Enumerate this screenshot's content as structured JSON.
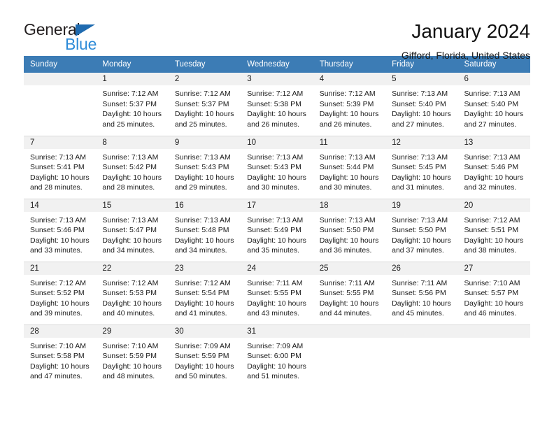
{
  "brand": {
    "name_part1": "General",
    "name_part2": "Blue",
    "triangle_color": "#1f6bb0",
    "blue_text_color": "#2e8bd8"
  },
  "header": {
    "title": "January 2024",
    "location": "Gifford, Florida, United States",
    "header_bg_color": "#3c7cb5",
    "daynum_bg_color": "#f1f1f1"
  },
  "weekday_headers": [
    "Sunday",
    "Monday",
    "Tuesday",
    "Wednesday",
    "Thursday",
    "Friday",
    "Saturday"
  ],
  "labels": {
    "sunrise_prefix": "Sunrise:",
    "sunset_prefix": "Sunset:",
    "daylight_prefix": "Daylight:"
  },
  "weeks": [
    [
      {
        "day": "",
        "blank": true,
        "line1": "",
        "line2": "",
        "line3": "",
        "line4": ""
      },
      {
        "day": "1",
        "line1": "Sunrise: 7:12 AM",
        "line2": "Sunset: 5:37 PM",
        "line3": "Daylight: 10 hours",
        "line4": "and 25 minutes."
      },
      {
        "day": "2",
        "line1": "Sunrise: 7:12 AM",
        "line2": "Sunset: 5:37 PM",
        "line3": "Daylight: 10 hours",
        "line4": "and 25 minutes."
      },
      {
        "day": "3",
        "line1": "Sunrise: 7:12 AM",
        "line2": "Sunset: 5:38 PM",
        "line3": "Daylight: 10 hours",
        "line4": "and 26 minutes."
      },
      {
        "day": "4",
        "line1": "Sunrise: 7:12 AM",
        "line2": "Sunset: 5:39 PM",
        "line3": "Daylight: 10 hours",
        "line4": "and 26 minutes."
      },
      {
        "day": "5",
        "line1": "Sunrise: 7:13 AM",
        "line2": "Sunset: 5:40 PM",
        "line3": "Daylight: 10 hours",
        "line4": "and 27 minutes."
      },
      {
        "day": "6",
        "line1": "Sunrise: 7:13 AM",
        "line2": "Sunset: 5:40 PM",
        "line3": "Daylight: 10 hours",
        "line4": "and 27 minutes."
      }
    ],
    [
      {
        "day": "7",
        "line1": "Sunrise: 7:13 AM",
        "line2": "Sunset: 5:41 PM",
        "line3": "Daylight: 10 hours",
        "line4": "and 28 minutes."
      },
      {
        "day": "8",
        "line1": "Sunrise: 7:13 AM",
        "line2": "Sunset: 5:42 PM",
        "line3": "Daylight: 10 hours",
        "line4": "and 28 minutes."
      },
      {
        "day": "9",
        "line1": "Sunrise: 7:13 AM",
        "line2": "Sunset: 5:43 PM",
        "line3": "Daylight: 10 hours",
        "line4": "and 29 minutes."
      },
      {
        "day": "10",
        "line1": "Sunrise: 7:13 AM",
        "line2": "Sunset: 5:43 PM",
        "line3": "Daylight: 10 hours",
        "line4": "and 30 minutes."
      },
      {
        "day": "11",
        "line1": "Sunrise: 7:13 AM",
        "line2": "Sunset: 5:44 PM",
        "line3": "Daylight: 10 hours",
        "line4": "and 30 minutes."
      },
      {
        "day": "12",
        "line1": "Sunrise: 7:13 AM",
        "line2": "Sunset: 5:45 PM",
        "line3": "Daylight: 10 hours",
        "line4": "and 31 minutes."
      },
      {
        "day": "13",
        "line1": "Sunrise: 7:13 AM",
        "line2": "Sunset: 5:46 PM",
        "line3": "Daylight: 10 hours",
        "line4": "and 32 minutes."
      }
    ],
    [
      {
        "day": "14",
        "line1": "Sunrise: 7:13 AM",
        "line2": "Sunset: 5:46 PM",
        "line3": "Daylight: 10 hours",
        "line4": "and 33 minutes."
      },
      {
        "day": "15",
        "line1": "Sunrise: 7:13 AM",
        "line2": "Sunset: 5:47 PM",
        "line3": "Daylight: 10 hours",
        "line4": "and 34 minutes."
      },
      {
        "day": "16",
        "line1": "Sunrise: 7:13 AM",
        "line2": "Sunset: 5:48 PM",
        "line3": "Daylight: 10 hours",
        "line4": "and 34 minutes."
      },
      {
        "day": "17",
        "line1": "Sunrise: 7:13 AM",
        "line2": "Sunset: 5:49 PM",
        "line3": "Daylight: 10 hours",
        "line4": "and 35 minutes."
      },
      {
        "day": "18",
        "line1": "Sunrise: 7:13 AM",
        "line2": "Sunset: 5:50 PM",
        "line3": "Daylight: 10 hours",
        "line4": "and 36 minutes."
      },
      {
        "day": "19",
        "line1": "Sunrise: 7:13 AM",
        "line2": "Sunset: 5:50 PM",
        "line3": "Daylight: 10 hours",
        "line4": "and 37 minutes."
      },
      {
        "day": "20",
        "line1": "Sunrise: 7:12 AM",
        "line2": "Sunset: 5:51 PM",
        "line3": "Daylight: 10 hours",
        "line4": "and 38 minutes."
      }
    ],
    [
      {
        "day": "21",
        "line1": "Sunrise: 7:12 AM",
        "line2": "Sunset: 5:52 PM",
        "line3": "Daylight: 10 hours",
        "line4": "and 39 minutes."
      },
      {
        "day": "22",
        "line1": "Sunrise: 7:12 AM",
        "line2": "Sunset: 5:53 PM",
        "line3": "Daylight: 10 hours",
        "line4": "and 40 minutes."
      },
      {
        "day": "23",
        "line1": "Sunrise: 7:12 AM",
        "line2": "Sunset: 5:54 PM",
        "line3": "Daylight: 10 hours",
        "line4": "and 41 minutes."
      },
      {
        "day": "24",
        "line1": "Sunrise: 7:11 AM",
        "line2": "Sunset: 5:55 PM",
        "line3": "Daylight: 10 hours",
        "line4": "and 43 minutes."
      },
      {
        "day": "25",
        "line1": "Sunrise: 7:11 AM",
        "line2": "Sunset: 5:55 PM",
        "line3": "Daylight: 10 hours",
        "line4": "and 44 minutes."
      },
      {
        "day": "26",
        "line1": "Sunrise: 7:11 AM",
        "line2": "Sunset: 5:56 PM",
        "line3": "Daylight: 10 hours",
        "line4": "and 45 minutes."
      },
      {
        "day": "27",
        "line1": "Sunrise: 7:10 AM",
        "line2": "Sunset: 5:57 PM",
        "line3": "Daylight: 10 hours",
        "line4": "and 46 minutes."
      }
    ],
    [
      {
        "day": "28",
        "line1": "Sunrise: 7:10 AM",
        "line2": "Sunset: 5:58 PM",
        "line3": "Daylight: 10 hours",
        "line4": "and 47 minutes."
      },
      {
        "day": "29",
        "line1": "Sunrise: 7:10 AM",
        "line2": "Sunset: 5:59 PM",
        "line3": "Daylight: 10 hours",
        "line4": "and 48 minutes."
      },
      {
        "day": "30",
        "line1": "Sunrise: 7:09 AM",
        "line2": "Sunset: 5:59 PM",
        "line3": "Daylight: 10 hours",
        "line4": "and 50 minutes."
      },
      {
        "day": "31",
        "line1": "Sunrise: 7:09 AM",
        "line2": "Sunset: 6:00 PM",
        "line3": "Daylight: 10 hours",
        "line4": "and 51 minutes."
      },
      {
        "day": "",
        "blank": true,
        "line1": "",
        "line2": "",
        "line3": "",
        "line4": ""
      },
      {
        "day": "",
        "blank": true,
        "line1": "",
        "line2": "",
        "line3": "",
        "line4": ""
      },
      {
        "day": "",
        "blank": true,
        "line1": "",
        "line2": "",
        "line3": "",
        "line4": ""
      }
    ]
  ]
}
